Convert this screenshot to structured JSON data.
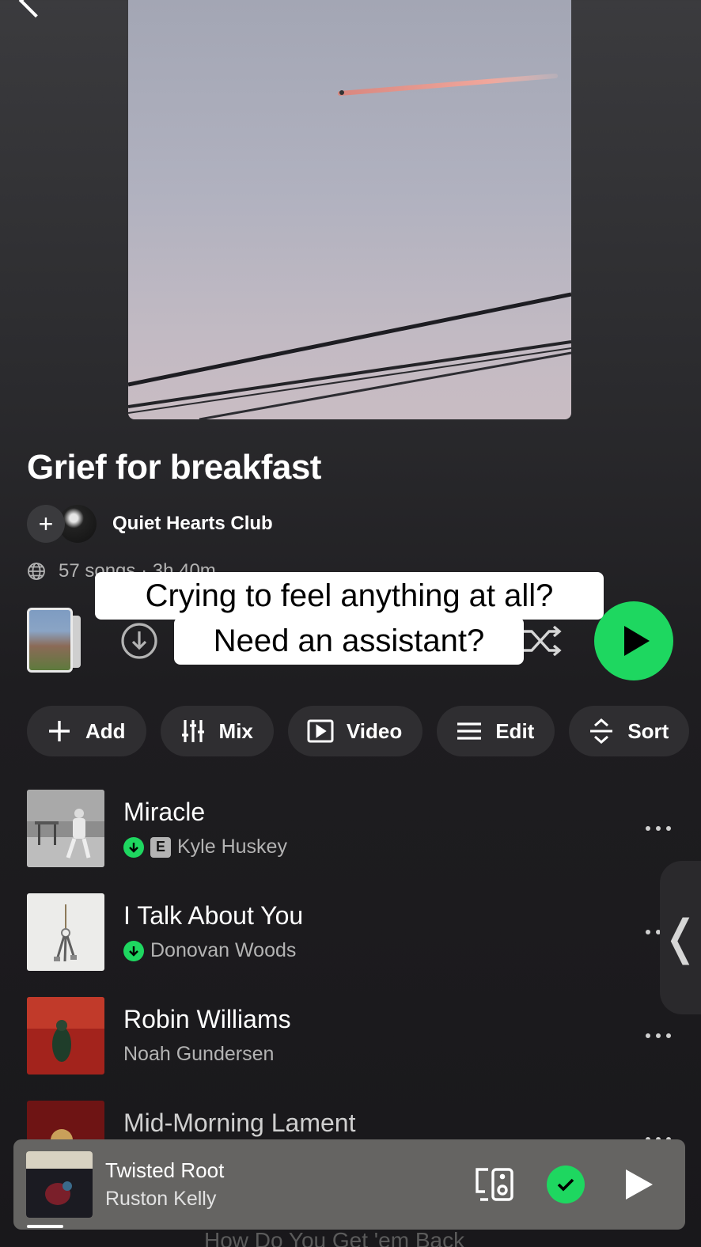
{
  "playlist": {
    "title": "Grief for breakfast",
    "owner": "Quiet Hearts Club",
    "meta": "57 songs · 3h 40m"
  },
  "caption": {
    "line1": "Crying to feel anything at all?",
    "line2": "Need an assistant?"
  },
  "chips": [
    {
      "label": "Add",
      "icon": "plus-icon"
    },
    {
      "label": "Mix",
      "icon": "sliders-icon"
    },
    {
      "label": "Video",
      "icon": "video-icon"
    },
    {
      "label": "Edit",
      "icon": "list-icon"
    },
    {
      "label": "Sort",
      "icon": "sort-icon"
    }
  ],
  "tracks": [
    {
      "title": "Miracle",
      "artist": "Kyle Huskey",
      "downloaded": true,
      "explicit": true,
      "explicit_label": "E"
    },
    {
      "title": "I Talk About You",
      "artist": "Donovan Woods",
      "downloaded": true,
      "explicit": false
    },
    {
      "title": "Robin Williams",
      "artist": "Noah Gundersen",
      "downloaded": false,
      "explicit": false
    },
    {
      "title": "Mid-Morning Lament",
      "artist": "",
      "downloaded": false,
      "explicit": false
    }
  ],
  "now_playing": {
    "title": "Twisted Root",
    "artist": "Ruston Kelly",
    "next_hint": "How Do You Get 'em Back",
    "saved": true
  },
  "colors": {
    "accent": "#1ed760",
    "background": "#19181b",
    "mini_player": "#656462"
  }
}
